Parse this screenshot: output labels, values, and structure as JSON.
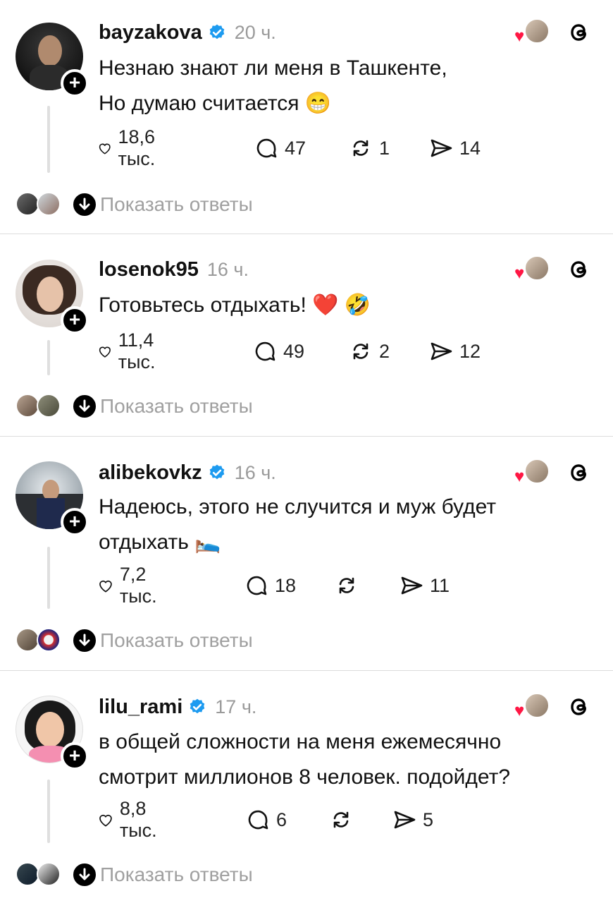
{
  "posts": [
    {
      "username": "bayzakova",
      "verified": true,
      "time": "20 ч.",
      "text_lines": [
        "Незнаю знают ли меня в Ташкенте,",
        "Но думаю считается 😁"
      ],
      "likes": "18,6 тыс.",
      "comments": "47",
      "reposts": "1",
      "shares": "14",
      "show_replies": "Показать ответы"
    },
    {
      "username": "losenok95",
      "verified": false,
      "time": "16 ч.",
      "text_lines": [
        "Готовьтесь отдыхать! ❤️ 🤣"
      ],
      "likes": "11,4 тыс.",
      "comments": "49",
      "reposts": "2",
      "shares": "12",
      "show_replies": "Показать ответы"
    },
    {
      "username": "alibekovkz",
      "verified": true,
      "time": "16 ч.",
      "text_lines": [
        "Надеюсь, этого не случится и муж будет",
        "отдыхать 🛌"
      ],
      "likes": "7,2 тыс.",
      "comments": "18",
      "reposts": "",
      "shares": "11",
      "show_replies": "Показать ответы"
    },
    {
      "username": "lilu_rami",
      "verified": true,
      "time": "17 ч.",
      "text_lines": [
        "в общей сложности на меня ежемесячно",
        "смотрит миллионов 8 человек. подойдет?"
      ],
      "likes": "8,8 тыс.",
      "comments": "6",
      "reposts": "",
      "shares": "5",
      "show_replies": "Показать ответы"
    }
  ],
  "icons": {
    "like": "heart-outline-icon",
    "comment": "comment-bubble-icon",
    "repost": "repost-arrows-icon",
    "share": "send-icon",
    "verified": "verified-badge-icon",
    "threads": "threads-logo-icon",
    "follow": "plus-icon",
    "expand": "arrow-down-icon"
  },
  "colors": {
    "verified": "#1d9bf0",
    "heart": "#ff1744",
    "muted_text": "#9a9a9a"
  }
}
